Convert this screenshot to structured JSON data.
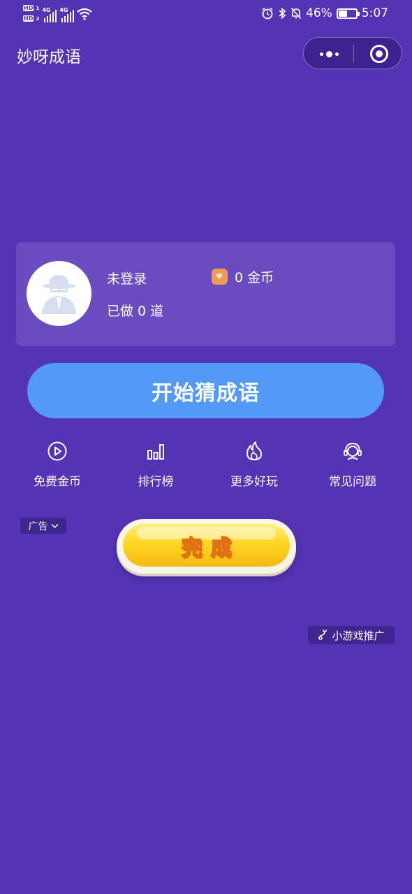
{
  "status_bar": {
    "hd1": "HD",
    "hd2": "HD",
    "network1": "4G",
    "network2": "4G",
    "battery_percent": "46%",
    "battery_level": 0.46,
    "time": "5:07",
    "icons": [
      "alarm-icon",
      "bluetooth-icon",
      "mute-icon",
      "battery-icon",
      "wifi-icon"
    ]
  },
  "nav": {
    "title": "妙呀成语"
  },
  "profile": {
    "username": "未登录",
    "coins_label": "0 金币",
    "done_label": "已做 0 道"
  },
  "actions": {
    "start_label": "开始猜成语",
    "features": [
      {
        "label": "免费金币",
        "icon": "play-circle-icon"
      },
      {
        "label": "排行榜",
        "icon": "bar-chart-icon"
      },
      {
        "label": "更多好玩",
        "icon": "flame-icon"
      },
      {
        "label": "常见问题",
        "icon": "customer-service-icon"
      }
    ]
  },
  "ad": {
    "tag_label": "广告",
    "complete_label": "完成",
    "promo_label": "小游戏推广"
  },
  "colors": {
    "background": "#5434b5",
    "card": "#6a4cc0",
    "start_button": "#5399f8",
    "complete_button": "#ffd624",
    "coin": "#f29a55"
  }
}
